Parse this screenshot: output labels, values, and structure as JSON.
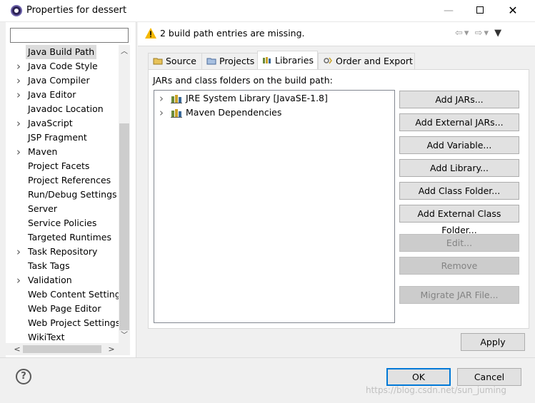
{
  "window": {
    "title": "Properties for dessert",
    "minimize": "—",
    "close": "✕"
  },
  "filter": {
    "value": "",
    "placeholder": ""
  },
  "tree": [
    {
      "label": "Java Build Path",
      "expandable": false,
      "selected": true
    },
    {
      "label": "Java Code Style",
      "expandable": true
    },
    {
      "label": "Java Compiler",
      "expandable": true
    },
    {
      "label": "Java Editor",
      "expandable": true
    },
    {
      "label": "Javadoc Location",
      "expandable": false
    },
    {
      "label": "JavaScript",
      "expandable": true
    },
    {
      "label": "JSP Fragment",
      "expandable": false
    },
    {
      "label": "Maven",
      "expandable": true
    },
    {
      "label": "Project Facets",
      "expandable": false
    },
    {
      "label": "Project References",
      "expandable": false
    },
    {
      "label": "Run/Debug Settings",
      "expandable": false
    },
    {
      "label": "Server",
      "expandable": false
    },
    {
      "label": "Service Policies",
      "expandable": false
    },
    {
      "label": "Targeted Runtimes",
      "expandable": false
    },
    {
      "label": "Task Repository",
      "expandable": true
    },
    {
      "label": "Task Tags",
      "expandable": false
    },
    {
      "label": "Validation",
      "expandable": true
    },
    {
      "label": "Web Content Settings",
      "expandable": false
    },
    {
      "label": "Web Page Editor",
      "expandable": false
    },
    {
      "label": "Web Project Settings",
      "expandable": false
    },
    {
      "label": "WikiText",
      "expandable": false
    }
  ],
  "header": {
    "message": "2 build path entries are missing."
  },
  "tabs": [
    {
      "label": "Source"
    },
    {
      "label": "Projects"
    },
    {
      "label": "Libraries",
      "active": true
    },
    {
      "label": "Order and Export"
    }
  ],
  "libraries": {
    "caption": "JARs and class folders on the build path:",
    "entries": [
      {
        "label": "JRE System Library [JavaSE-1.8]"
      },
      {
        "label": "Maven Dependencies"
      }
    ],
    "buttons": [
      {
        "label": "Add JARs...",
        "enabled": true
      },
      {
        "label": "Add External JARs...",
        "enabled": true
      },
      {
        "label": "Add Variable...",
        "enabled": true
      },
      {
        "label": "Add Library...",
        "enabled": true
      },
      {
        "label": "Add Class Folder...",
        "enabled": true
      },
      {
        "label": "Add External Class Folder...",
        "enabled": true
      },
      {
        "label": "Edit...",
        "enabled": false
      },
      {
        "label": "Remove",
        "enabled": false
      },
      {
        "label": "Migrate JAR File...",
        "enabled": false
      }
    ]
  },
  "actions": {
    "apply": "Apply",
    "ok": "OK",
    "cancel": "Cancel",
    "help": "?"
  },
  "watermark": "https://blog.csdn.net/sun_juming",
  "colors": {
    "accent": "#0078d7",
    "warning": "#f5b800"
  }
}
